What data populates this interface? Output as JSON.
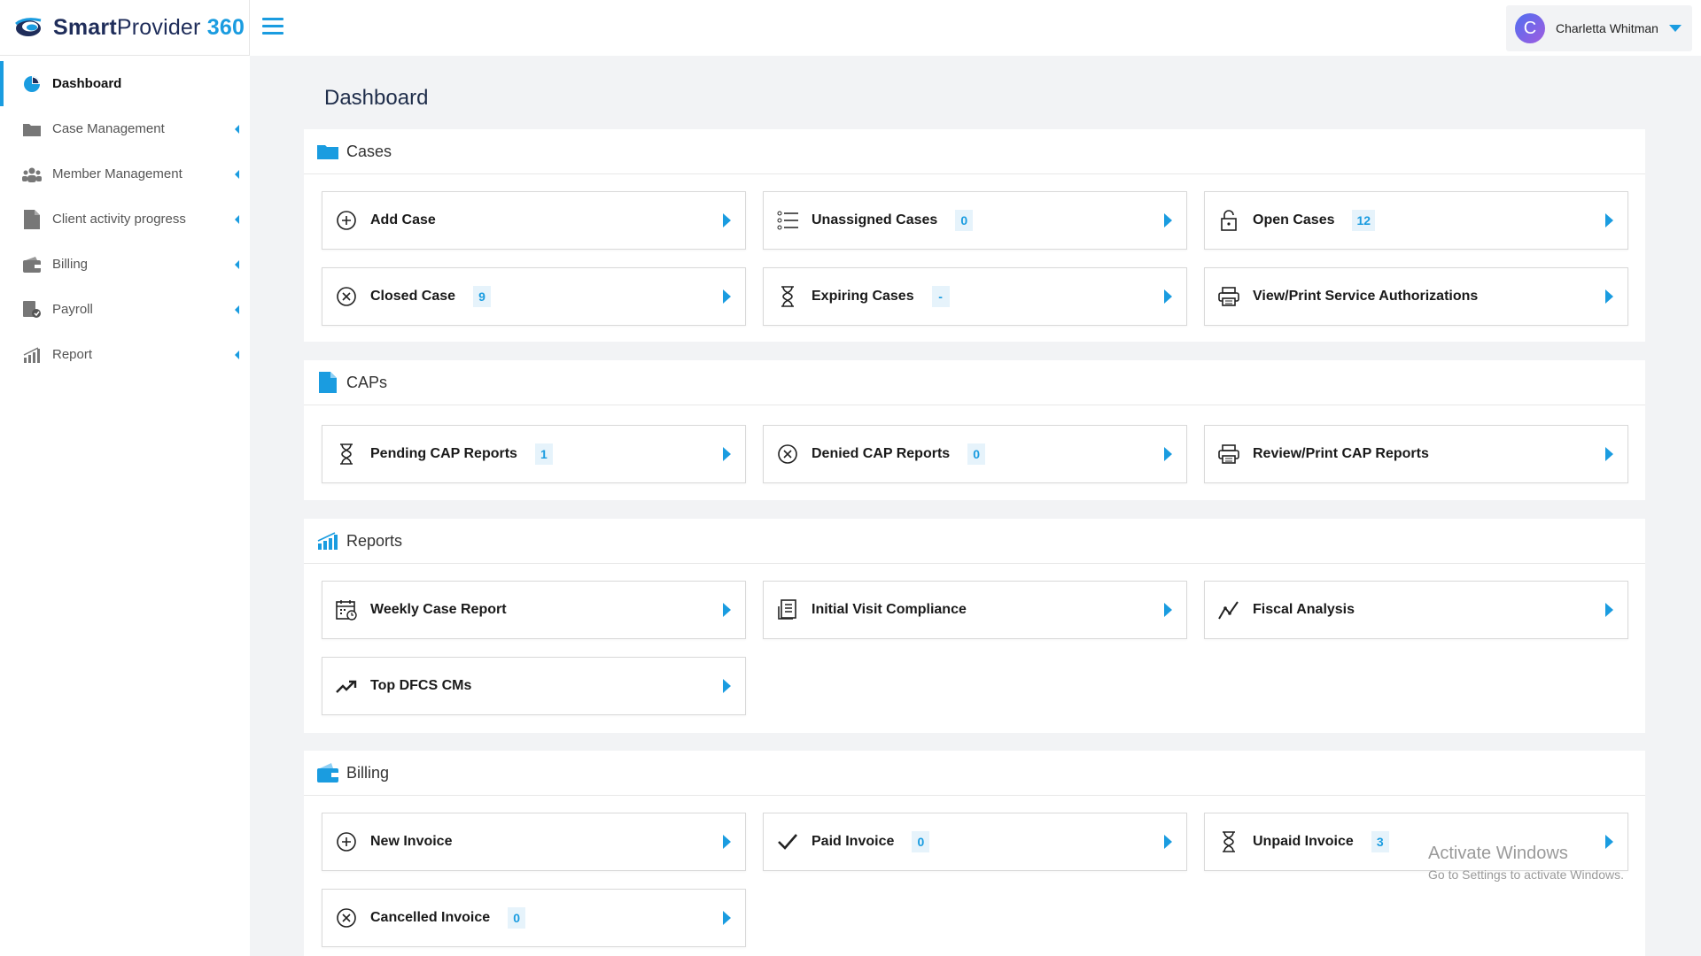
{
  "brand": {
    "smart": "Smart",
    "provider": "Provider",
    "num": "360"
  },
  "user": {
    "initial": "C",
    "name": "Charletta Whitman"
  },
  "colors": {
    "accent": "#1a9ce0",
    "brand_dark": "#1f2d5a"
  },
  "sidebar": {
    "items": [
      {
        "label": "Dashboard",
        "icon": "pie-chart-icon"
      },
      {
        "label": "Case Management",
        "icon": "folder-icon"
      },
      {
        "label": "Member Management",
        "icon": "people-icon"
      },
      {
        "label": "Client activity progress",
        "icon": "document-icon"
      },
      {
        "label": "Billing",
        "icon": "wallet-icon"
      },
      {
        "label": "Payroll",
        "icon": "payroll-icon"
      },
      {
        "label": "Report",
        "icon": "bar-chart-icon"
      }
    ]
  },
  "main": {
    "title": "Dashboard",
    "sections": {
      "cases": {
        "title": "Cases",
        "cards": [
          {
            "label": "Add Case",
            "icon": "plus-circle-icon"
          },
          {
            "label": "Unassigned Cases",
            "badge": "0",
            "icon": "list-icon"
          },
          {
            "label": "Open Cases",
            "badge": "12",
            "icon": "lock-icon"
          },
          {
            "label": "Closed Case",
            "badge": "9",
            "icon": "x-circle-icon"
          },
          {
            "label": "Expiring Cases",
            "badge": "-",
            "icon": "hourglass-icon"
          },
          {
            "label": "View/Print Service Authorizations",
            "icon": "printer-icon"
          }
        ]
      },
      "caps": {
        "title": "CAPs",
        "cards": [
          {
            "label": "Pending CAP Reports",
            "badge": "1",
            "icon": "hourglass-icon"
          },
          {
            "label": "Denied CAP Reports",
            "badge": "0",
            "icon": "x-circle-icon"
          },
          {
            "label": "Review/Print CAP Reports",
            "icon": "printer-icon"
          }
        ]
      },
      "reports": {
        "title": "Reports",
        "cards": [
          {
            "label": "Weekly Case Report",
            "icon": "calendar-icon"
          },
          {
            "label": "Initial Visit Compliance",
            "icon": "receipt-icon"
          },
          {
            "label": "Fiscal Analysis",
            "icon": "line-chart-icon"
          },
          {
            "label": "Top DFCS CMs",
            "icon": "trending-up-icon"
          }
        ]
      },
      "billing": {
        "title": "Billing",
        "cards": [
          {
            "label": "New Invoice",
            "icon": "plus-circle-icon"
          },
          {
            "label": "Paid Invoice",
            "badge": "0",
            "icon": "check-icon"
          },
          {
            "label": "Unpaid Invoice",
            "badge": "3",
            "icon": "hourglass-icon"
          },
          {
            "label": "Cancelled Invoice",
            "badge": "0",
            "icon": "x-circle-icon"
          }
        ]
      }
    }
  },
  "watermark": {
    "line1": "Activate Windows",
    "line2": "Go to Settings to activate Windows."
  }
}
